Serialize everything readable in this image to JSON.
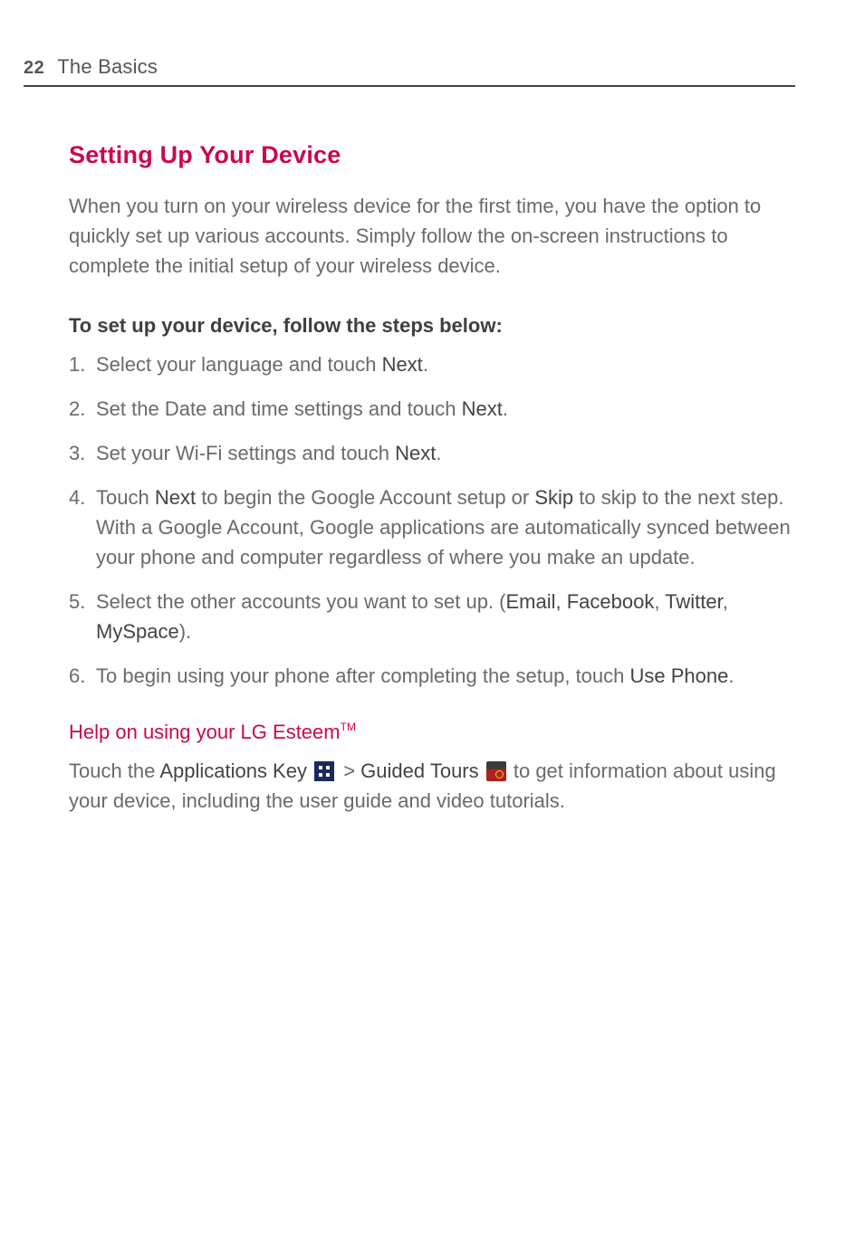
{
  "header": {
    "page_number": "22",
    "section": "The Basics"
  },
  "heading_main": "Setting Up Your Device",
  "intro": "When you turn on your wireless device for the first time, you have the option to quickly set up various accounts. Simply follow the on-screen instructions to complete the initial setup of your wireless device.",
  "subheading_steps": "To set up your device, follow the steps below:",
  "steps": [
    {
      "pre": "Select your language and touch ",
      "b1": "Next",
      "post": "."
    },
    {
      "pre": "Set the Date and time settings and touch ",
      "b1": "Next",
      "post": "."
    },
    {
      "pre": "Set your Wi-Fi settings and touch ",
      "b1": "Next",
      "post": "."
    },
    {
      "pre": "Touch ",
      "b1": "Next",
      "mid1": " to begin the Google Account setup or ",
      "b2": "Skip",
      "post": " to skip to the next step. With a Google Account, Google applications are automatically synced between your phone and computer regardless of where you make an update."
    },
    {
      "pre": "Select the other accounts you want to set up. (",
      "b1": "Email, Facebook",
      "mid1": ", ",
      "b2": "Twitter",
      "mid2": ", ",
      "b3": "MySpace",
      "post": ")."
    },
    {
      "pre": "To begin using your phone after completing the setup, touch ",
      "b1": "Use Phone",
      "post": "."
    }
  ],
  "subheading_help": "Help on using your LG Esteem",
  "help_tm": "TM",
  "help": {
    "t1": "Touch the ",
    "b1": "Applications Key",
    "sep1": "  > ",
    "b2": "Guided Tours",
    "t2": " to get information about using your device, including the user guide and video tutorials."
  },
  "icons": {
    "apps": "applications-key-icon",
    "tours": "guided-tours-icon"
  }
}
